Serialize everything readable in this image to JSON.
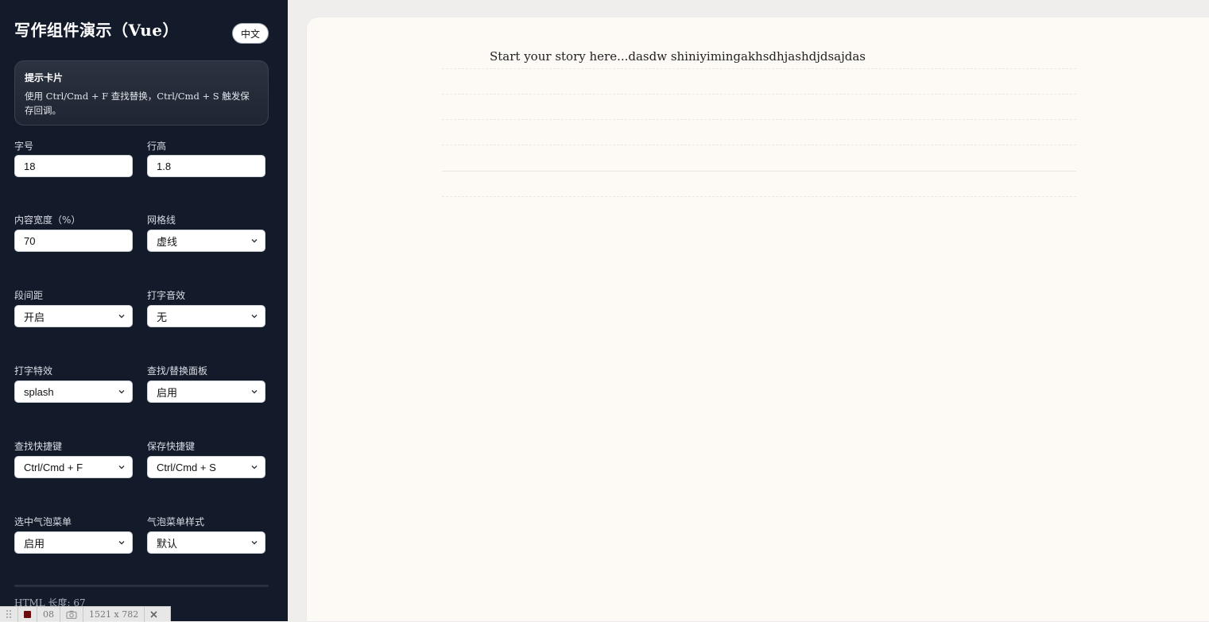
{
  "sidebar": {
    "title": "写作组件演示（Vue）",
    "lang_button": "中文",
    "tip": {
      "title": "提示卡片",
      "body": "使用 Ctrl/Cmd + F 查找替换，Ctrl/Cmd + S 触发保存回调。"
    },
    "fields": {
      "font_size": {
        "label": "字号",
        "value": "18"
      },
      "line_height": {
        "label": "行高",
        "value": "1.8"
      },
      "content_width": {
        "label": "内容宽度（%）",
        "value": "70"
      },
      "grid_lines": {
        "label": "网格线",
        "value": "虚线"
      },
      "paragraph_spacing": {
        "label": "段间距",
        "value": "开启"
      },
      "typing_sound": {
        "label": "打字音效",
        "value": "无"
      },
      "typing_effect": {
        "label": "打字特效",
        "value": "splash"
      },
      "find_replace_panel": {
        "label": "查找/替换面板",
        "value": "启用"
      },
      "find_shortcut": {
        "label": "查找快捷键",
        "value": "Ctrl/Cmd + F"
      },
      "save_shortcut": {
        "label": "保存快捷键",
        "value": "Ctrl/Cmd + S"
      },
      "bubble_menu": {
        "label": "选中气泡菜单",
        "value": "启用"
      },
      "bubble_style": {
        "label": "气泡菜单样式",
        "value": "默认"
      }
    },
    "html_length": "HTML 长度: 67"
  },
  "devbar": {
    "count": "08",
    "dimensions": "1521 x 782"
  },
  "editor": {
    "text": "Start your story here...dasdw shiniyimingakhsdhjashdjdsajdas"
  },
  "colors": {
    "sidebar_bg": "#131a2a",
    "editor_bg": "#fdf9f4",
    "page_bg": "#efeeec"
  }
}
